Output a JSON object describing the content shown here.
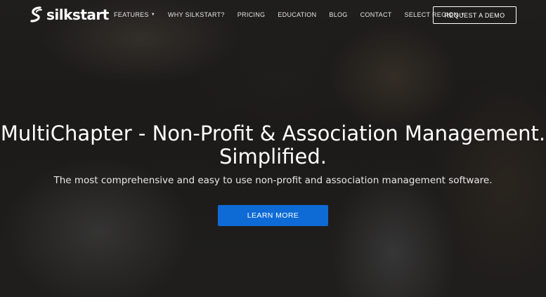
{
  "brand": {
    "name": "silkstart",
    "logo_icon": "silkstart-swoosh-icon"
  },
  "nav": {
    "items": [
      {
        "label": "FEATURES",
        "dropdown": true
      },
      {
        "label": "WHY SILKSTART?",
        "dropdown": false
      },
      {
        "label": "PRICING",
        "dropdown": false
      },
      {
        "label": "EDUCATION",
        "dropdown": false
      },
      {
        "label": "BLOG",
        "dropdown": false
      },
      {
        "label": "CONTACT",
        "dropdown": false
      },
      {
        "label": "SELECT REGION",
        "dropdown": true
      }
    ],
    "demo_label": "REQUEST A DEMO"
  },
  "hero": {
    "title_line1": "MultiChapter - Non-Profit & Association Management.",
    "title_line2": "Simplified.",
    "subtitle": "The most comprehensive and easy to use non-profit and association management software.",
    "cta_label": "LEARN MORE"
  },
  "colors": {
    "cta_background": "#0e6bd6",
    "text": "#ffffff",
    "hero_overlay": "#1e1c1b"
  }
}
